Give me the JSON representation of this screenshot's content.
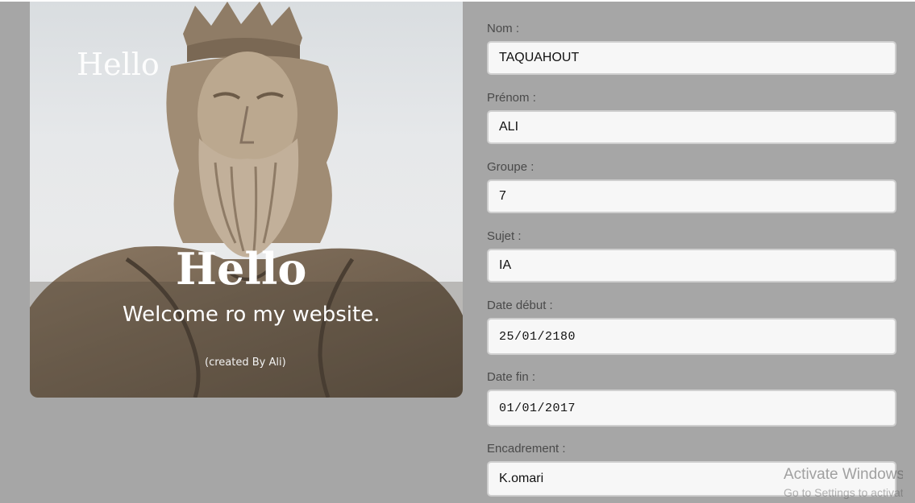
{
  "hero": {
    "hello_small": "Hello",
    "hello_big": "Hello",
    "welcome": "Welcome ro my website.",
    "credit": "(created By Ali)"
  },
  "form": {
    "fields": [
      {
        "label": "Nom :",
        "value": "TAQUAHOUT"
      },
      {
        "label": "Prénom :",
        "value": "ALI"
      },
      {
        "label": "Groupe :",
        "value": "7"
      },
      {
        "label": "Sujet :",
        "value": "IA"
      },
      {
        "label": "Date début :",
        "value": "25/01/2180"
      },
      {
        "label": "Date fin :",
        "value": "01/01/2017"
      },
      {
        "label": "Encadrement :",
        "value": "K.omari"
      }
    ]
  },
  "watermark": {
    "title": "Activate Windows",
    "subtitle": "Go to Settings to activate Windows."
  }
}
